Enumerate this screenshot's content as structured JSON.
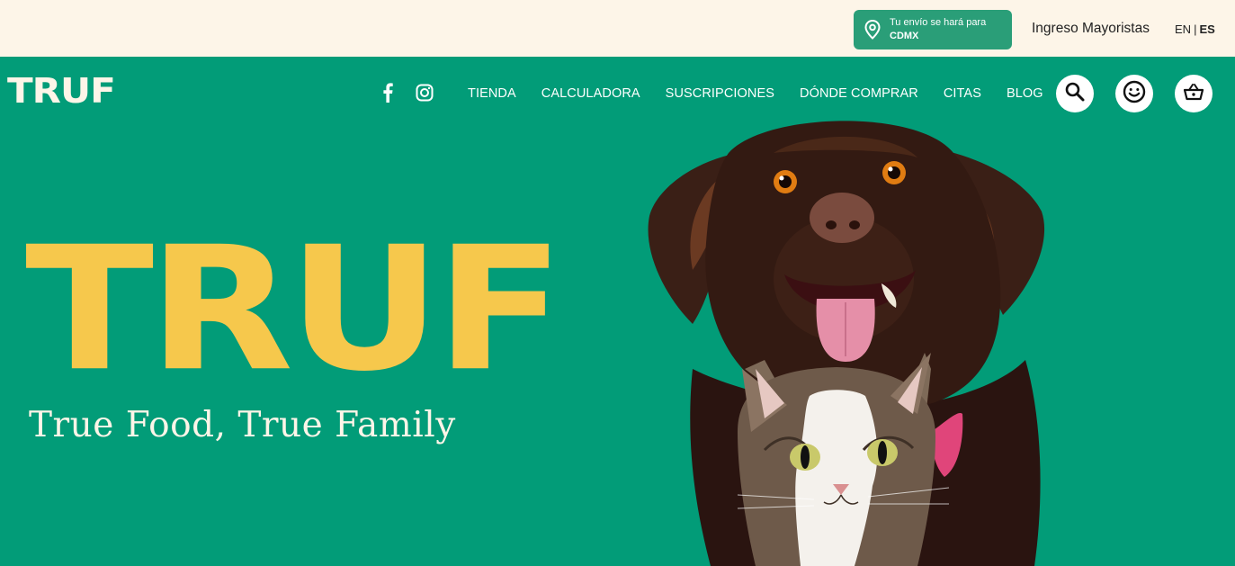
{
  "topbar": {
    "shipping_line1": "Tu envío se hará para",
    "shipping_city": "CDMX",
    "wholesale_label": "Ingreso Mayoristas",
    "lang_en": "EN",
    "lang_sep": "|",
    "lang_es": "ES"
  },
  "nav": {
    "logo": "TRUF",
    "links": [
      "TIENDA",
      "CALCULADORA",
      "SUSCRIPCIONES",
      "DÓNDE COMPRAR",
      "CITAS",
      "BLOG"
    ]
  },
  "hero": {
    "title": "TRUF",
    "subtitle": "True Food, True Family"
  },
  "colors": {
    "brand_green": "#029C78",
    "cream": "#FDF5E8",
    "yellow": "#F6C84C"
  },
  "icons": {
    "pin": "location-pin-icon",
    "facebook": "facebook-icon",
    "instagram": "instagram-icon",
    "search": "search-icon",
    "account": "smiley-face-icon",
    "cart": "shopping-basket-icon"
  }
}
